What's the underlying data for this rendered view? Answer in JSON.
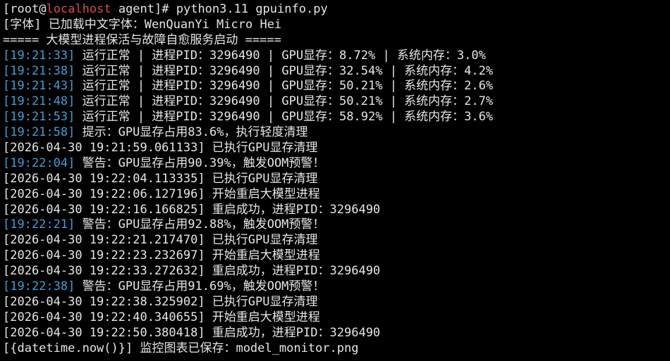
{
  "prompt": {
    "user": "root",
    "at": "@",
    "host": "localhost",
    "dir": "agent",
    "command": "python3.11 gpuinfo.py"
  },
  "colors": {
    "background": "#000000",
    "text": "#e6e6e6",
    "timestamp": "#3d9fd6",
    "hostname": "#d94b4b"
  },
  "font_line": "[字体] 已加载中文字体：WenQuanYi Micro Hei",
  "banner_line": "===== 大模型进程保活与故障自愈服务启动 =====",
  "status_lines": [
    {
      "time": "[19:21:33]",
      "text": " 运行正常 | 进程PID：3296490 | GPU显存：8.72% | 系统内存：3.0%"
    },
    {
      "time": "[19:21:38]",
      "text": " 运行正常 | 进程PID：3296490 | GPU显存：32.54% | 系统内存：4.2%"
    },
    {
      "time": "[19:21:43]",
      "text": " 运行正常 | 进程PID：3296490 | GPU显存：50.21% | 系统内存：2.6%"
    },
    {
      "time": "[19:21:48]",
      "text": " 运行正常 | 进程PID：3296490 | GPU显存：50.21% | 系统内存：2.7%"
    },
    {
      "time": "[19:21:53]",
      "text": " 运行正常 | 进程PID：3296490 | GPU显存：58.92% | 系统内存：3.6%"
    }
  ],
  "hint_line": {
    "time": "[19:21:58]",
    "text": " 提示：GPU显存占用83.6%，执行轻度清理"
  },
  "log1": "[2026-04-30 19:21:59.061133] 已执行GPU显存清理",
  "warn1": {
    "time": "[19:22:04]",
    "text": " 警告：GPU显存占用90.39%，触发OOM预警！"
  },
  "log2": "[2026-04-30 19:22:04.113335] 已执行GPU显存清理",
  "log3": "[2026-04-30 19:22:06.127196] 开始重启大模型进程",
  "log4": "[2026-04-30 19:22:16.166825] 重启成功，进程PID：3296490",
  "warn2": {
    "time": "[19:22:21]",
    "text": " 警告：GPU显存占用92.88%，触发OOM预警！"
  },
  "log5": "[2026-04-30 19:22:21.217470] 已执行GPU显存清理",
  "log6": "[2026-04-30 19:22:23.232697] 开始重启大模型进程",
  "log7": "[2026-04-30 19:22:33.272632] 重启成功，进程PID：3296490",
  "warn3": {
    "time": "[19:22:38]",
    "text": " 警告：GPU显存占用91.69%，触发OOM预警！"
  },
  "log8": "[2026-04-30 19:22:38.325902] 已执行GPU显存清理",
  "log9": "[2026-04-30 19:22:40.340655] 开始重启大模型进程",
  "log10": "[2026-04-30 19:22:50.380418] 重启成功，进程PID：3296490",
  "save_line": "[{datetime.now()}] 监控图表已保存：model_monitor.png"
}
